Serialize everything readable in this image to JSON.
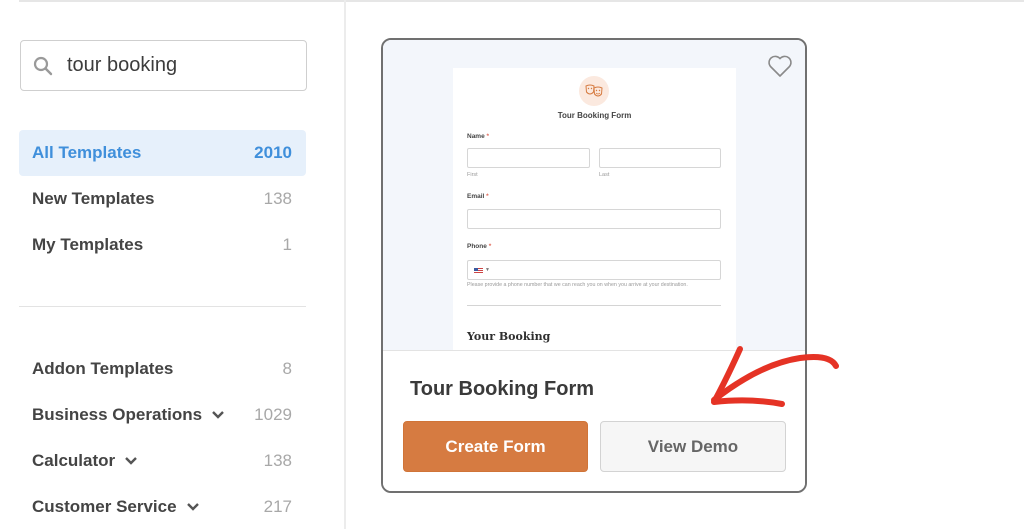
{
  "search": {
    "value": "tour booking",
    "icon": "search-icon"
  },
  "nav": {
    "primary": [
      {
        "label": "All Templates",
        "count": "2010",
        "active": true
      },
      {
        "label": "New Templates",
        "count": "138",
        "active": false
      },
      {
        "label": "My Templates",
        "count": "1",
        "active": false
      }
    ],
    "categories": [
      {
        "label": "Addon Templates",
        "count": "8",
        "expandable": false
      },
      {
        "label": "Business Operations",
        "count": "1029",
        "expandable": true
      },
      {
        "label": "Calculator",
        "count": "138",
        "expandable": true
      },
      {
        "label": "Customer Service",
        "count": "217",
        "expandable": true
      }
    ]
  },
  "card": {
    "title": "Tour Booking Form",
    "favorite_icon": "heart-icon",
    "create_label": "Create Form",
    "demo_label": "View Demo",
    "accent_color": "#d67b41",
    "preview": {
      "form_title": "Tour Booking Form",
      "logo_icon": "theater-masks-icon",
      "name_label": "Name",
      "name_first": "First",
      "name_last": "Last",
      "email_label": "Email",
      "phone_label": "Phone",
      "phone_help": "Please provide a phone number that we can reach you on when you arrive at your destination.",
      "required_mark": "*",
      "section_title": "Your Booking"
    }
  },
  "annotation": {
    "arrow_color": "#e53325",
    "points_to": "View Demo"
  }
}
